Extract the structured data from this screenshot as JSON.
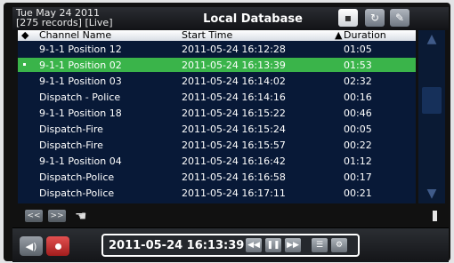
{
  "header": {
    "date": "Tue May 24 2011",
    "records": "[275 records]  [Live]",
    "title": "Local Database"
  },
  "table": {
    "columns": [
      "Channel Name",
      "Start Time",
      "Duration"
    ],
    "rows": [
      {
        "channel": "9-1-1 Position 12",
        "start": "2011-05-24  16:12:28",
        "duration": "01:05"
      },
      {
        "channel": "9-1-1 Position 02",
        "start": "2011-05-24  16:13:39",
        "duration": "01:53"
      },
      {
        "channel": "9-1-1 Position 03",
        "start": "2011-05-24  16:14:02",
        "duration": "02:32"
      },
      {
        "channel": "Dispatch - Police",
        "start": "2011-05-24  16:14:16",
        "duration": "00:16"
      },
      {
        "channel": "9-1-1 Position 18",
        "start": "2011-05-24  16:15:22",
        "duration": "00:46"
      },
      {
        "channel": "Dispatch-Fire",
        "start": "2011-05-24  16:15:24",
        "duration": "00:05"
      },
      {
        "channel": "Dispatch-Fire",
        "start": "2011-05-24  16:15:57",
        "duration": "00:22"
      },
      {
        "channel": "9-1-1 Position 04",
        "start": "2011-05-24  16:16:42",
        "duration": "01:12"
      },
      {
        "channel": "Dispatch-Police",
        "start": "2011-05-24  16:16:58",
        "duration": "00:17"
      },
      {
        "channel": "Dispatch-Police",
        "start": "2011-05-24  16:17:11",
        "duration": "00:21"
      }
    ],
    "selected_row": 1
  },
  "player": {
    "timestamp": "2011-05-24  16:13:39"
  },
  "icons": {
    "top_buttons": [
      "window-icon",
      "refresh-icon",
      "wrench-icon"
    ],
    "nav": [
      "prev-page-icon",
      "next-page-icon",
      "hand-icon"
    ],
    "player": [
      "speaker-icon",
      "record-icon",
      "rewind-icon",
      "pause-icon",
      "fast-forward-icon",
      "list-icon",
      "settings-icon"
    ]
  },
  "colors": {
    "table_bg": "#081937",
    "selected_row": "#3ab44a",
    "record_button": "#c62f2f"
  }
}
